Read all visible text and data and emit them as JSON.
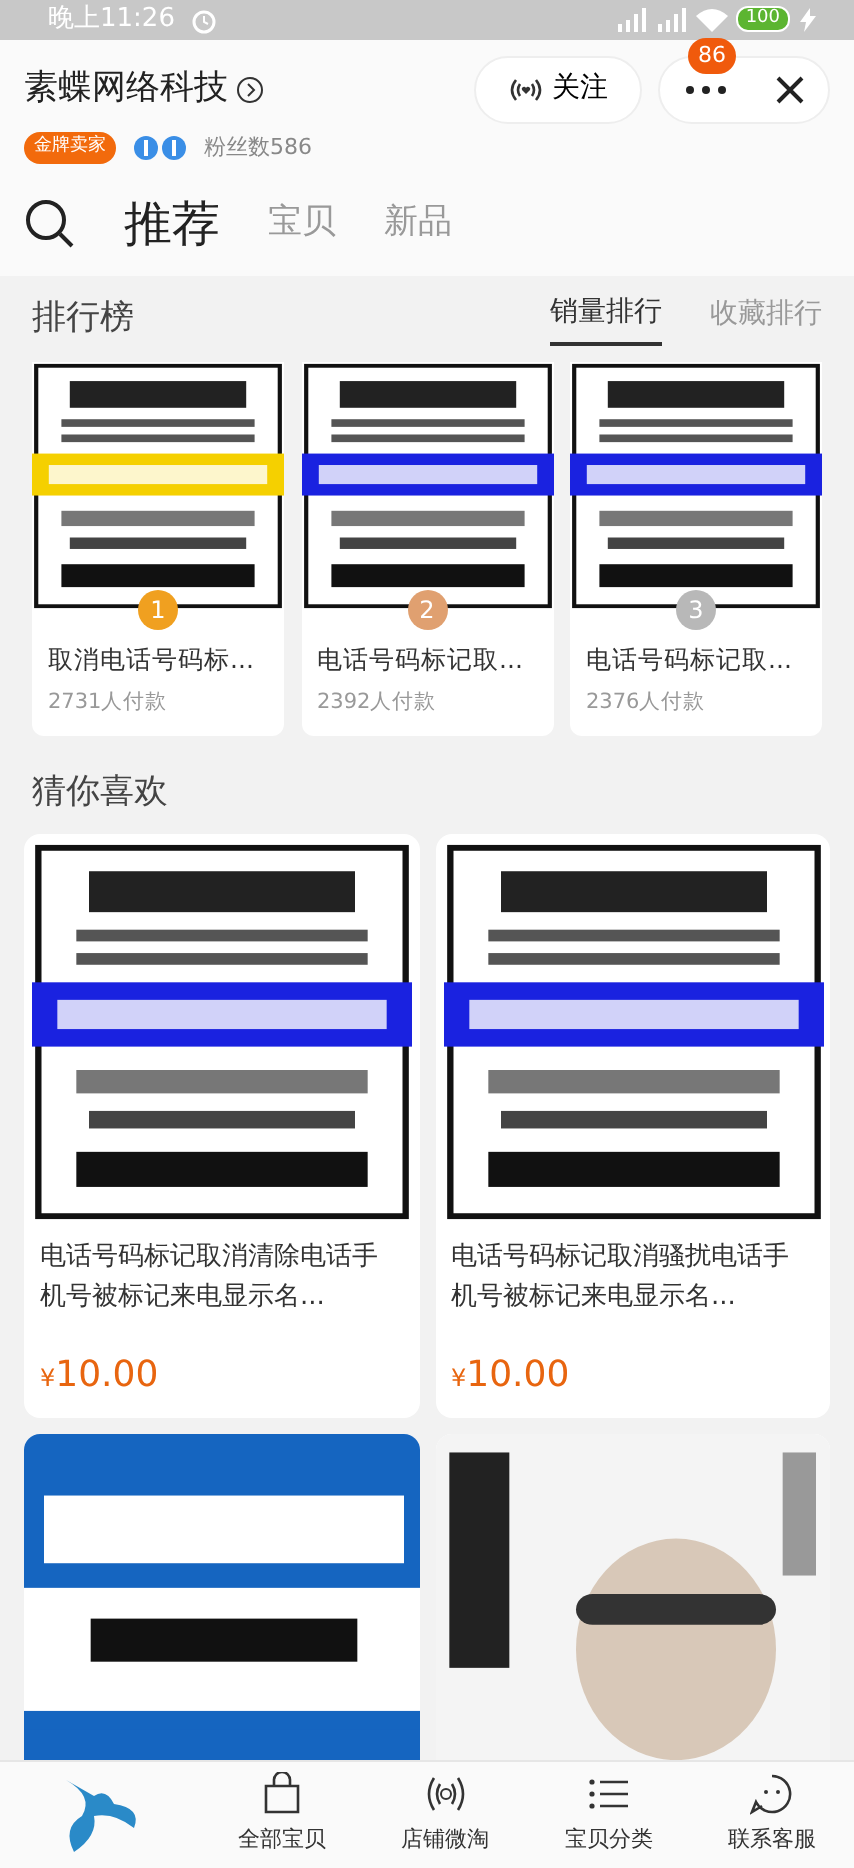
{
  "status_bar": {
    "time": "晚上11:26",
    "battery": "100"
  },
  "shop": {
    "name": "素蝶网络科技",
    "badge": "金牌卖家",
    "fans": "粉丝数586",
    "follow_button": "关注",
    "more_count": "86"
  },
  "tabs": [
    {
      "label": "推荐",
      "selected": true
    },
    {
      "label": "宝贝",
      "selected": false
    },
    {
      "label": "新品",
      "selected": false
    }
  ],
  "ranking": {
    "title": "排行榜",
    "sort_tabs": [
      {
        "label": "销量排行",
        "selected": true
      },
      {
        "label": "收藏排行",
        "selected": false
      }
    ],
    "items": [
      {
        "rank": "1",
        "color": "#f0a020",
        "title": "取消电话号码标...",
        "sales": "2731人付款"
      },
      {
        "rank": "2",
        "color": "#e0a070",
        "title": "电话号码标记取...",
        "sales": "2392人付款"
      },
      {
        "rank": "3",
        "color": "#b8b8b8",
        "title": "电话号码标记取...",
        "sales": "2376人付款"
      }
    ]
  },
  "guess": {
    "title": "猜你喜欢",
    "items": [
      {
        "kind": "product",
        "title": "电话号码标记取消清除电话手机号被标记来电显示名...",
        "currency": "¥",
        "price": "10.00"
      },
      {
        "kind": "product",
        "title": "电话号码标记取消骚扰电话手机号被标记来电显示名...",
        "currency": "¥",
        "price": "10.00"
      },
      {
        "kind": "picture"
      },
      {
        "kind": "picture"
      }
    ]
  },
  "bottom_nav": {
    "items": [
      {
        "label": "全部宝贝"
      },
      {
        "label": "店铺微淘"
      },
      {
        "label": "宝贝分类"
      },
      {
        "label": "联系客服"
      }
    ]
  }
}
